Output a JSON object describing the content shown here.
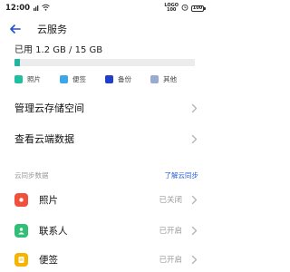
{
  "status_bar": {
    "time": "12:00",
    "left_icons": [
      "sim-icon",
      "wifi-icon"
    ],
    "right_logo": "LOGO\n100",
    "battery_level": "100"
  },
  "header": {
    "title": "云服务"
  },
  "storage": {
    "usage_text": "已用 1.2 GB / 15 GB",
    "used_fraction": 0.03,
    "legend": [
      {
        "label": "照片",
        "color": "#1fbf9f"
      },
      {
        "label": "便签",
        "color": "#3aa8e8"
      },
      {
        "label": "备份",
        "color": "#1f3fc6"
      },
      {
        "label": "其他",
        "color": "#9aa9cf"
      }
    ]
  },
  "menu": [
    {
      "label": "管理云存储空间"
    },
    {
      "label": "查看云端数据"
    }
  ],
  "section": {
    "title": "云同步数据",
    "link": "了解云同步"
  },
  "apps": [
    {
      "label": "照片",
      "status": "已关闭",
      "icon": "photos-icon",
      "color": "#f0503c"
    },
    {
      "label": "联系人",
      "status": "已开启",
      "icon": "contacts-icon",
      "color": "#2fbf77"
    },
    {
      "label": "便签",
      "status": "已开启",
      "icon": "notes-icon",
      "color": "#f4b400"
    }
  ],
  "colors": {
    "accent": "#1fb7a1",
    "link": "#2a5fd6",
    "back_arrow": "#1e4fd1"
  }
}
